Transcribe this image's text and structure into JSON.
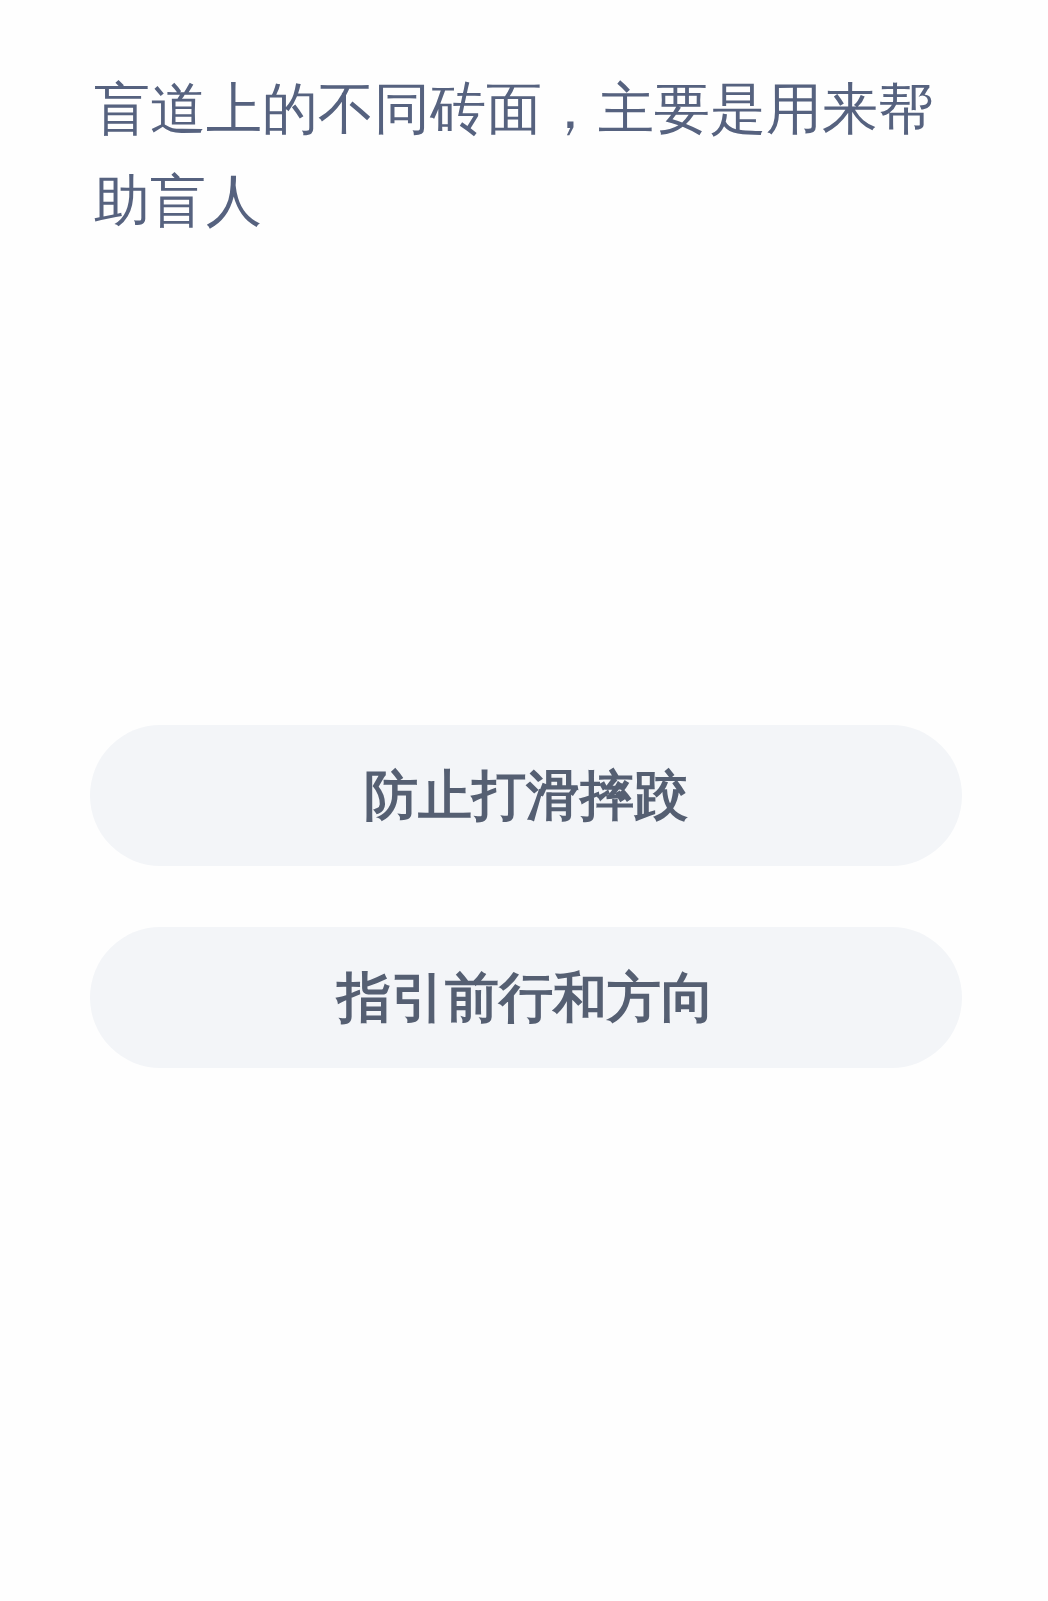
{
  "question": "盲道上的不同砖面，主要是用来帮助盲人",
  "options": [
    {
      "label": "防止打滑摔跤"
    },
    {
      "label": "指引前行和方向"
    }
  ]
}
